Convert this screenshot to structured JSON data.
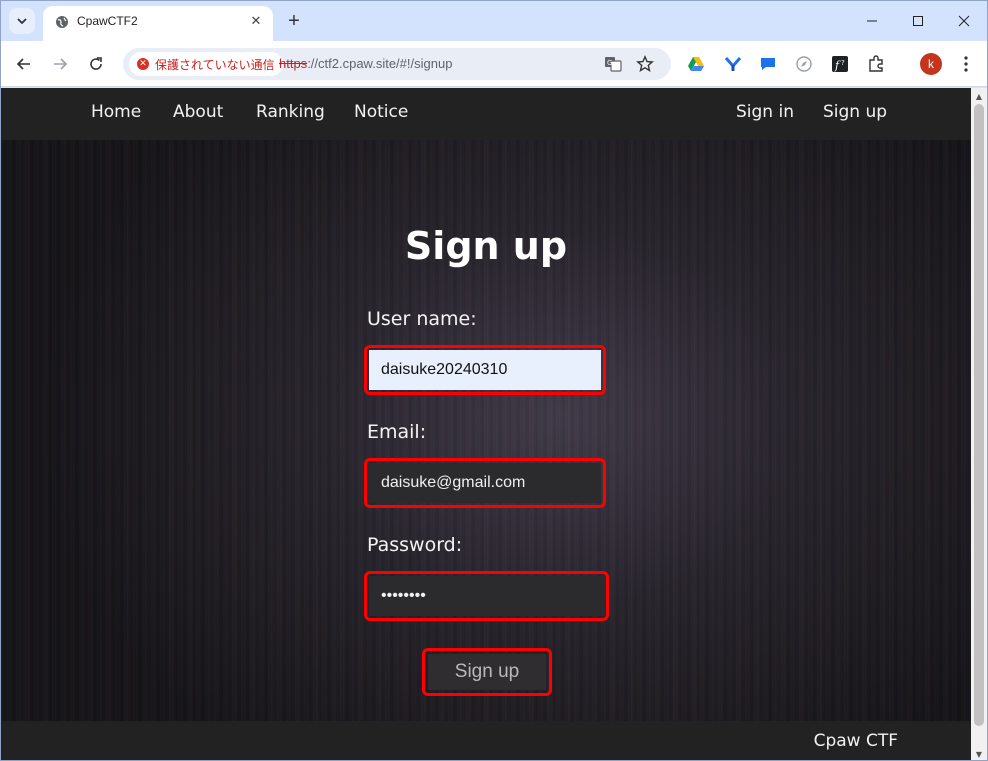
{
  "browser": {
    "tab_title": "CpawCTF2",
    "new_tab_symbol": "+",
    "tab_close_symbol": "✕",
    "security_label": "保護されていない通信",
    "url_scheme": "https",
    "url_rest": "://ctf2.cpaw.site/#!/signup",
    "profile_initial": "k",
    "icons": [
      "tab-search-icon",
      "globe-icon",
      "back-icon",
      "forward-icon",
      "reload-icon",
      "translate-icon",
      "star-icon",
      "drive-icon",
      "extension-y-icon",
      "chat-icon",
      "compass-icon",
      "function-icon",
      "puzzle-icon",
      "kebab-menu-icon",
      "minimize-icon",
      "maximize-icon",
      "close-icon"
    ],
    "colors": {
      "tabstrip": "#d3e3fd",
      "insecure_red": "#c5221f",
      "profile": "#c5341c"
    }
  },
  "site": {
    "nav_left": [
      "Home",
      "About",
      "Ranking",
      "Notice"
    ],
    "nav_right": [
      "Sign in",
      "Sign up"
    ],
    "heading": "Sign up",
    "form": {
      "username_label": "User name:",
      "username_value": "daisuke20240310",
      "email_label": "Email:",
      "email_value": "daisuke@gmail.com",
      "password_label": "Password:",
      "password_value": "••••••••",
      "submit_label": "Sign up"
    },
    "footer": "Cpaw CTF",
    "colors": {
      "nav_bg": "#222222",
      "highlight": "#ff0000"
    }
  }
}
